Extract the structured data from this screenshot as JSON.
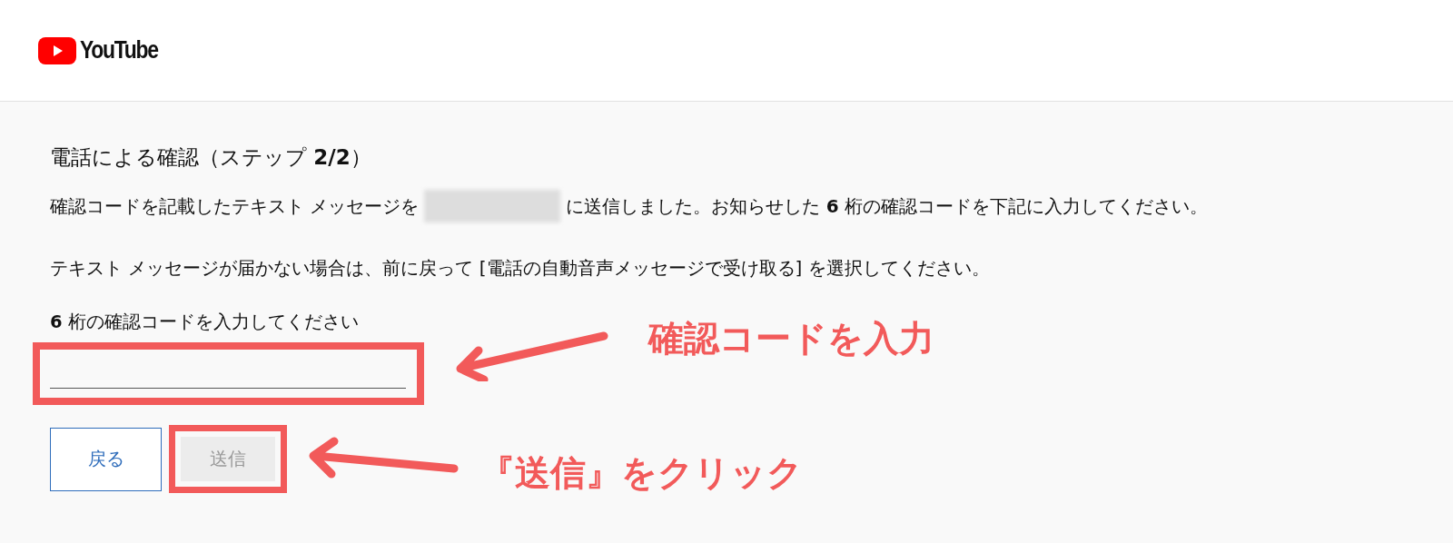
{
  "header": {
    "logo_text": "YouTube"
  },
  "title": "電話による確認（ステップ **2/2**）",
  "message": {
    "before": "確認コードを記載したテキスト メッセージを",
    "redacted": true,
    "after": "に送信しました。お知らせした **6** 桁の確認コードを下記に入力してください。"
  },
  "hint": "テキスト メッセージが届かない場合は、前に戻って [電話の自動音声メッセージで受け取る] を選択してください。",
  "code_field": {
    "label": "**6** 桁の確認コードを入力してください",
    "highlighted": true
  },
  "buttons": [
    {
      "label": "戻る",
      "kind": "outline",
      "disabled": false,
      "highlighted": false
    },
    {
      "label": "送信",
      "kind": "filled",
      "disabled": true,
      "highlighted": true
    }
  ],
  "annotations": [
    {
      "text": "確認コードを入力"
    },
    {
      "text": "『送信』をクリック"
    }
  ]
}
